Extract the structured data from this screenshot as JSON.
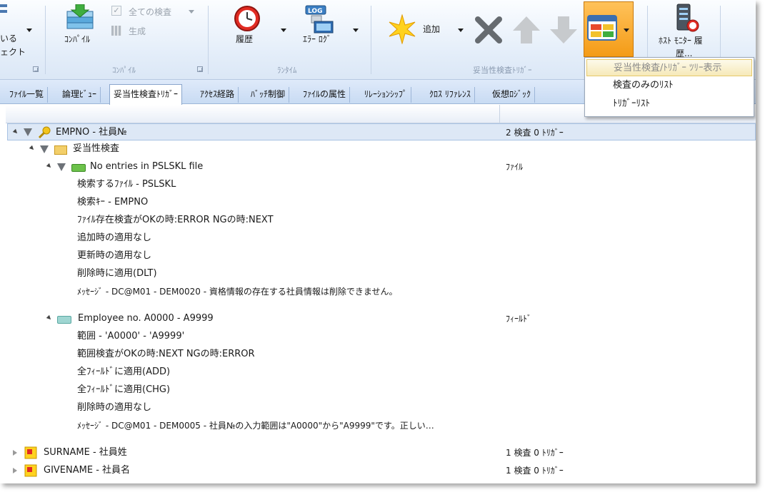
{
  "ribbon": {
    "left_cut_label_1": "いる",
    "left_cut_label_2": "ェクト",
    "compile_button": "ｺﾝﾊﾟｲﾙ",
    "check_all": "全ての検査",
    "generate": "生成",
    "group_compile": "ｺﾝﾊﾟｲﾙ",
    "history": "履歴",
    "error_log": "ｴﾗｰ ﾛｸﾞ",
    "group_runtime": "ﾗﾝﾀｲﾑ",
    "add": "追加",
    "group_validation": "妥当性検査ﾄﾘｶﾞｰ",
    "host_monitor": "ﾎｽﾄ ﾓﾆﾀｰ 履",
    "host_monitor_2": "歴...",
    "log_badge": "LOG"
  },
  "tabs": [
    {
      "label": "ﾌｧｲﾙ一覧"
    },
    {
      "label": "論理ﾋﾞｭｰ"
    },
    {
      "label": "妥当性検査ﾄﾘｶﾞｰ"
    },
    {
      "label": "ｱｸｾｽ経路"
    },
    {
      "label": "ﾊﾞｯﾁ制御"
    },
    {
      "label": "ﾌｧｲﾙの属性"
    },
    {
      "label": "ﾘﾚｰｼｮﾝｼｯﾌﾟ"
    },
    {
      "label": "ｸﾛｽ ﾘﾌｧﾚﾝｽ"
    },
    {
      "label": "仮想ﾛｼﾞｯｸ"
    }
  ],
  "popup": {
    "items": [
      {
        "label": "妥当性検査/ﾄﾘｶﾞｰ ﾂﾘｰ表示"
      },
      {
        "label": "検査のみのﾘｽﾄ"
      },
      {
        "label": "ﾄﾘｶﾞｰﾘｽﾄ"
      }
    ]
  },
  "tree": {
    "empno": {
      "label": "EMPNO - 社員№",
      "summary": "2 検査 0 ﾄﾘｶﾞｰ"
    },
    "validation_folder": {
      "label": "妥当性検査"
    },
    "check1": {
      "label": "No entries in PSLSKL file",
      "type": "ﾌｧｲﾙ",
      "details": [
        "検索するﾌｧｲﾙ - PSLSKL",
        "検索ｷｰ - EMPNO",
        "ﾌｧｲﾙ存在検査がOKの時:ERROR NGの時:NEXT",
        "追加時の適用なし",
        "更新時の適用なし",
        "削除時に適用(DLT)",
        "ﾒｯｾｰｼﾞ - DC@M01 - DEM0020 - 資格情報の存在する社員情報は削除できません。"
      ]
    },
    "check2": {
      "label": "Employee no. A0000 - A9999",
      "type": "ﾌｨｰﾙﾄﾞ",
      "details": [
        "範囲 - 'A0000' - 'A9999'",
        "範囲検査がOKの時:NEXT NGの時:ERROR",
        "全ﾌｨｰﾙﾄﾞに適用(ADD)",
        "全ﾌｨｰﾙﾄﾞに適用(CHG)",
        "削除時の適用なし",
        "ﾒｯｾｰｼﾞ - DC@M01 - DEM0005 - 社員№の入力範囲は\"A0000\"から\"A9999\"です。正しい…"
      ]
    },
    "surname": {
      "label": "SURNAME - 社員姓",
      "summary": "1 検査 0 ﾄﾘｶﾞｰ"
    },
    "givename": {
      "label": "GIVENAME - 社員名",
      "summary": "1 検査 0 ﾄﾘｶﾞｰ"
    }
  }
}
